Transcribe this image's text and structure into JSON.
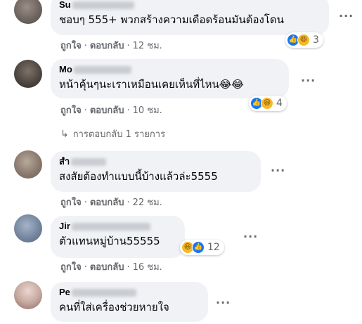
{
  "comments": [
    {
      "author": "Su",
      "text": "ชอบๆ 555+ พวกสร้างความเดือดร้อนมันต้องโดน",
      "like_label": "ถูกใจ",
      "reply_label": "ตอบกลับ",
      "time": "12 ชม.",
      "reaction_count": "3",
      "reactions": [
        "like-icon",
        "laughing-icon"
      ]
    },
    {
      "author": "Mo",
      "text": "หน้าคุ้นๆนะเราเหมือนเคยเห็นที่ไหน😂😂",
      "like_label": "ถูกใจ",
      "reply_label": "ตอบกลับ",
      "time": "10 ชม.",
      "reaction_count": "4",
      "reactions": [
        "like-icon",
        "laughing-icon"
      ],
      "replies_link": "การตอบกลับ 1 รายการ"
    },
    {
      "author": "สำ",
      "text": "สงสัยต้องทำแบบนี้บ้างแล้วล่ะ5555",
      "like_label": "ถูกใจ",
      "reply_label": "ตอบกลับ",
      "time": "22 ชม."
    },
    {
      "author": "Jir",
      "text": "ตัวแทนหมู่บ้าน55555",
      "like_label": "ถูกใจ",
      "reply_label": "ตอบกลับ",
      "time": "16 ชม.",
      "reaction_count": "12",
      "reactions": [
        "laughing-icon",
        "like-icon"
      ]
    },
    {
      "author": "Pe",
      "text": "คนที่ใส่เครื่องช่วยหายใจ"
    }
  ],
  "separator": "·",
  "more_glyph": "···",
  "colors": {
    "bubble": "#f0f2f5",
    "meta": "#65676b",
    "like": "#1877f2",
    "laugh": "#f7b928"
  }
}
